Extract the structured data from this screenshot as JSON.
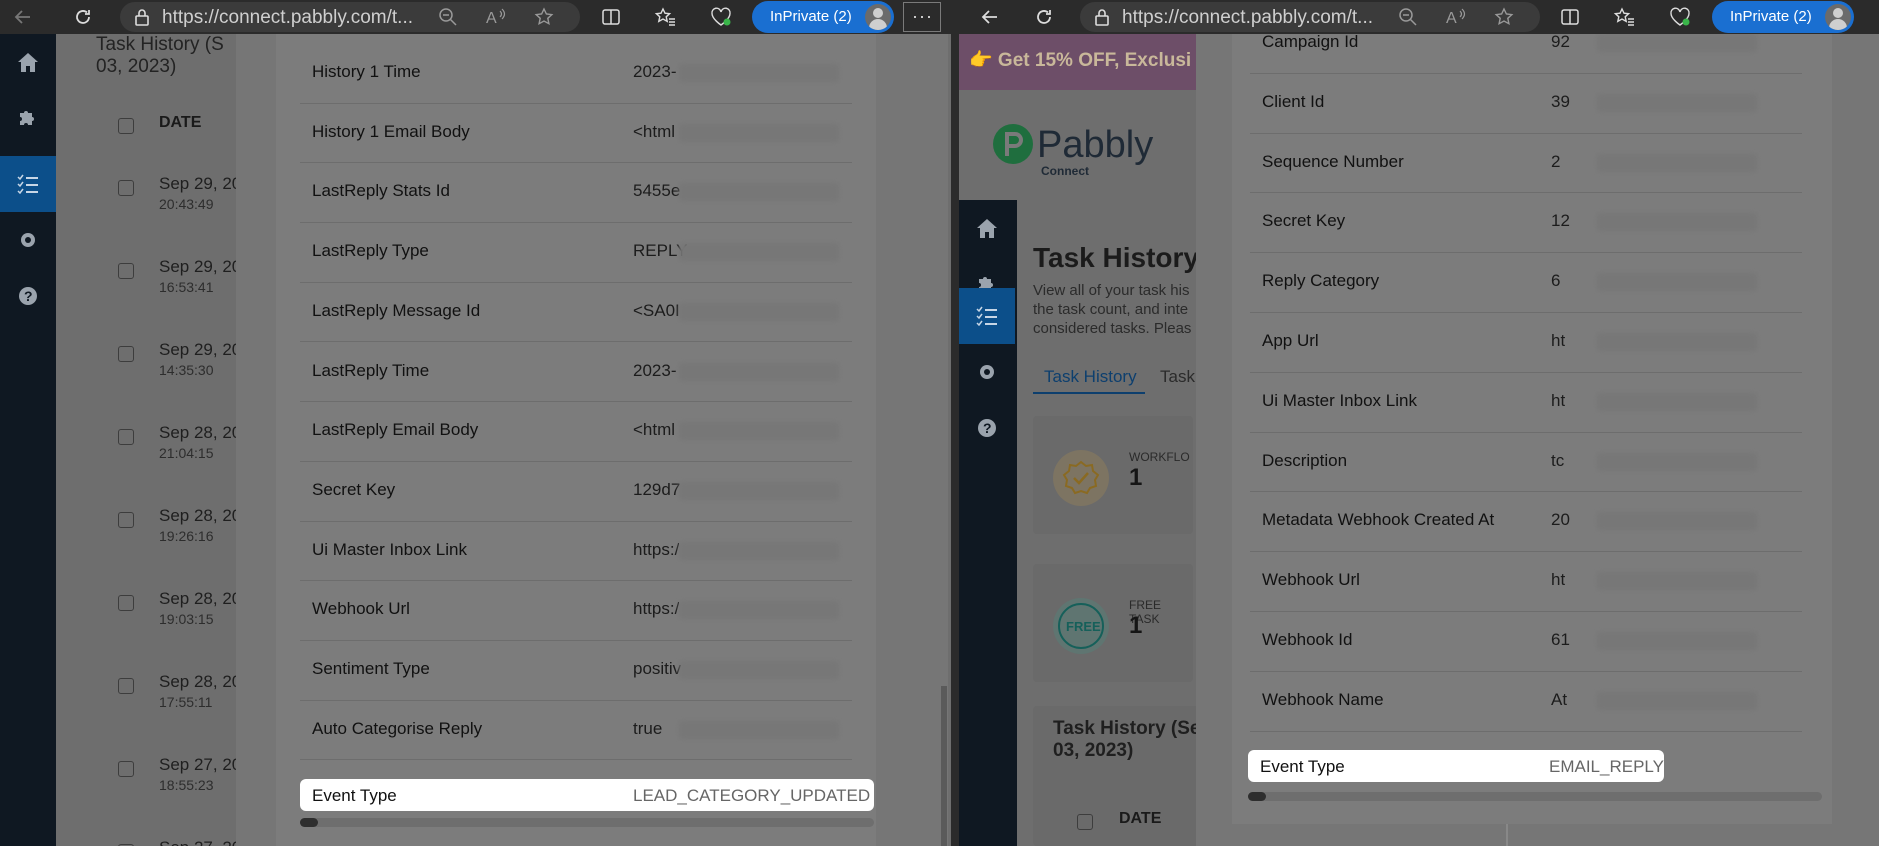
{
  "browser": {
    "url": "https://connect.pabbly.com/t...",
    "inprivate_label": "InPrivate (2)",
    "more_label": "···"
  },
  "left": {
    "bg_title_line1": "Task History (S",
    "bg_title_line2": "03, 2023)",
    "bg_date_header": "DATE",
    "bg_rows": [
      {
        "date": "Sep 29, 20",
        "time": "20:43:49"
      },
      {
        "date": "Sep 29, 20",
        "time": "16:53:41"
      },
      {
        "date": "Sep 29, 20",
        "time": "14:35:30"
      },
      {
        "date": "Sep 28, 20",
        "time": "21:04:15"
      },
      {
        "date": "Sep 28, 20",
        "time": "19:26:16"
      },
      {
        "date": "Sep 28, 20",
        "time": "19:03:15"
      },
      {
        "date": "Sep 28, 20",
        "time": "17:55:11"
      },
      {
        "date": "Sep 27, 20",
        "time": "18:55:23"
      },
      {
        "date": "Sep 27, 20",
        "time": ""
      }
    ],
    "rows": [
      {
        "label": "History 1 Time",
        "value": "2023-"
      },
      {
        "label": "History 1 Email Body",
        "value": "<html"
      },
      {
        "label": "LastReply Stats Id",
        "value": "5455e"
      },
      {
        "label": "LastReply Type",
        "value": "REPLY"
      },
      {
        "label": "LastReply Message Id",
        "value": "<SA0I"
      },
      {
        "label": "LastReply Time",
        "value": "2023-"
      },
      {
        "label": "LastReply Email Body",
        "value": "<html"
      },
      {
        "label": "Secret Key",
        "value": "129d7"
      },
      {
        "label": "Ui Master Inbox Link",
        "value": "https:/"
      },
      {
        "label": "Webhook Url",
        "value": "https:/"
      },
      {
        "label": "Sentiment Type",
        "value": "positiv"
      },
      {
        "label": "Auto Categorise Reply",
        "value": "true"
      }
    ],
    "highlight": {
      "label": "Event Type",
      "value": "LEAD_CATEGORY_UPDATED"
    }
  },
  "right": {
    "banner": "👉 Get 15% OFF, Exclusi",
    "logo_text": "Pabbly",
    "logo_sub": "Connect",
    "bg_title": "Task History",
    "bg_desc_1": "View all of your task his",
    "bg_desc_2": "the task count, and inte",
    "bg_desc_3": "considered tasks. Pleas",
    "tab_active": "Task History",
    "tab_other": "Task",
    "card1_label": "WORKFLO",
    "card1_value": "1",
    "card2_label": "FREE TASK",
    "card2_value": "1",
    "card2_badge": "FREE",
    "bottom_title_1": "Task History (Se",
    "bottom_title_2": "03, 2023)",
    "bottom_date": "DATE",
    "rows": [
      {
        "label": "Campaign Id",
        "value": "92"
      },
      {
        "label": "Client Id",
        "value": "39"
      },
      {
        "label": "Sequence Number",
        "value": "2"
      },
      {
        "label": "Secret Key",
        "value": "12"
      },
      {
        "label": "Reply Category",
        "value": "6"
      },
      {
        "label": "App Url",
        "value": "ht"
      },
      {
        "label": "Ui Master Inbox Link",
        "value": "ht"
      },
      {
        "label": "Description",
        "value": "tc"
      },
      {
        "label": "Metadata Webhook Created At",
        "value": "20"
      },
      {
        "label": "Webhook Url",
        "value": "ht"
      },
      {
        "label": "Webhook Id",
        "value": "61"
      },
      {
        "label": "Webhook Name",
        "value": "At"
      }
    ],
    "highlight": {
      "label": "Event Type",
      "value": "EMAIL_REPLY"
    }
  }
}
